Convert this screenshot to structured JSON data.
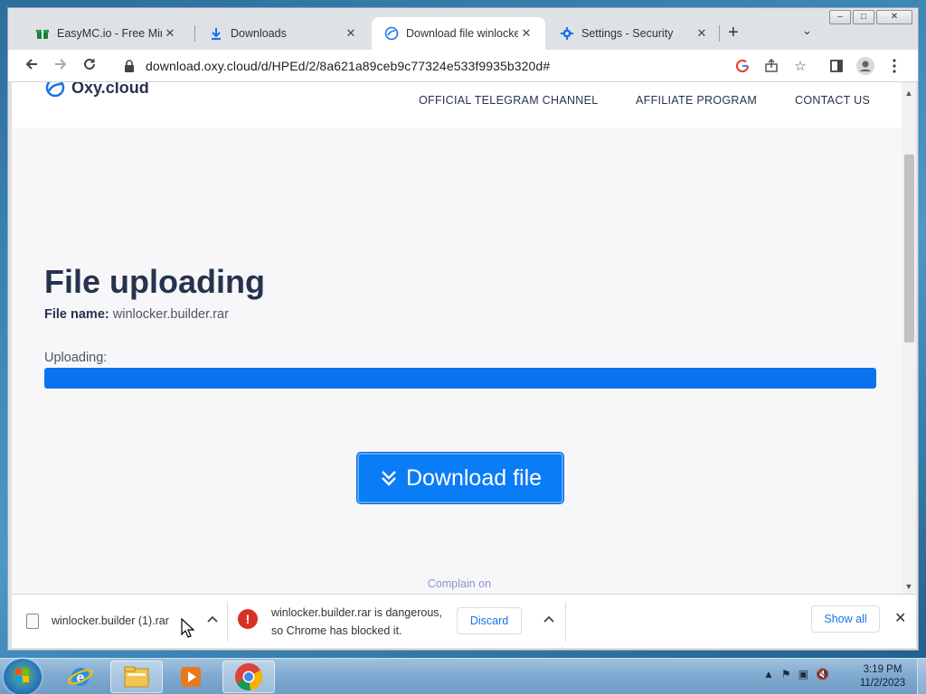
{
  "browser": {
    "tabs": [
      {
        "title": "EasyMC.io - Free Minecr",
        "icon": "gift-icon",
        "active": false
      },
      {
        "title": "Downloads",
        "icon": "download-icon",
        "active": false
      },
      {
        "title": "Download file winlocker",
        "icon": "oxy-cloud-icon",
        "active": true
      },
      {
        "title": "Settings - Security",
        "icon": "gear-icon",
        "active": false
      }
    ],
    "tab_close_glyph": "✕",
    "new_tab_glyph": "+",
    "tab_search_glyph": "⌄",
    "url": "download.oxy.cloud/d/HPEd/2/8a621a89ceb9c77324e533f9935b320d#"
  },
  "site": {
    "logo": "Oxy.cloud",
    "nav": [
      "OFFICIAL TELEGRAM CHANNEL",
      "AFFILIATE PROGRAM",
      "CONTACT US"
    ],
    "title": "File uploading",
    "file_label": "File name:",
    "file_name": "winlocker.builder.rar",
    "uploading_label": "Uploading:",
    "progress_percent": 100,
    "download_button": "Download file",
    "complain_text": "Complain on",
    "colors": {
      "accent": "#0a73f0",
      "heading": "#26334d"
    }
  },
  "download_shelf": {
    "item_name": "winlocker.builder (1).rar",
    "warning_line1": "winlocker.builder.rar is dangerous,",
    "warning_line2": "so Chrome has blocked it.",
    "discard_label": "Discard",
    "show_all_label": "Show all"
  },
  "taskbar": {
    "time": "3:19 PM",
    "date": "11/2/2023",
    "apps": [
      "internet-explorer-icon",
      "file-explorer-icon",
      "media-player-icon",
      "chrome-icon"
    ]
  }
}
